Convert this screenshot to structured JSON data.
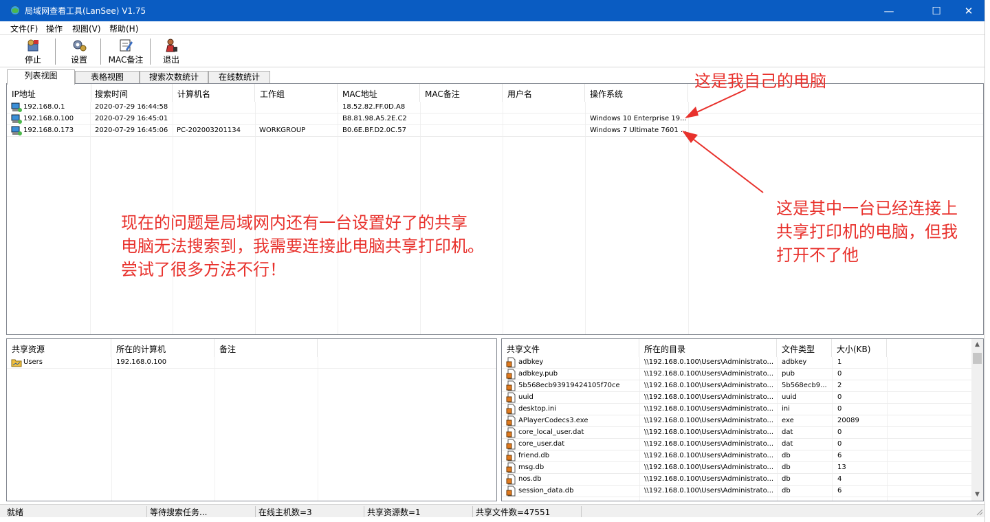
{
  "window": {
    "title": "局域网查看工具(LanSee) V1.75"
  },
  "menu": [
    "文件(F)",
    "操作",
    "视图(V)",
    "帮助(H)"
  ],
  "toolbar": {
    "stop": "停止",
    "settings": "设置",
    "mac_note": "MAC备注",
    "exit": "退出"
  },
  "tabs": [
    "列表视图",
    "表格视图",
    "搜索次数统计",
    "在线数统计"
  ],
  "hosts": {
    "columns": [
      "IP地址",
      "搜索时间",
      "计算机名",
      "工作组",
      "MAC地址",
      "MAC备注",
      "用户名",
      "操作系统"
    ],
    "rows": [
      [
        "192.168.0.1",
        "2020-07-29 16:44:58",
        "",
        "",
        "18.52.82.FF.0D.A8",
        "",
        "",
        ""
      ],
      [
        "192.168.0.100",
        "2020-07-29 16:45:01",
        "",
        "",
        "B8.81.98.A5.2E.C2",
        "",
        "",
        "Windows 10 Enterprise 19..."
      ],
      [
        "192.168.0.173",
        "2020-07-29 16:45:06",
        "PC-202003201134",
        "WORKGROUP",
        "B0.6E.BF.D2.0C.57",
        "",
        "",
        "Windows 7 Ultimate 7601 ..."
      ]
    ]
  },
  "shares": {
    "columns": [
      "共享资源",
      "所在的计算机",
      "备注"
    ],
    "rows": [
      [
        "Users",
        "192.168.0.100",
        ""
      ]
    ]
  },
  "files": {
    "columns": [
      "共享文件",
      "所在的目录",
      "文件类型",
      "大小(KB)"
    ],
    "rows": [
      [
        "adbkey",
        "\\\\192.168.0.100\\Users\\Administrato...",
        "adbkey",
        "1"
      ],
      [
        "adbkey.pub",
        "\\\\192.168.0.100\\Users\\Administrato...",
        "pub",
        "0"
      ],
      [
        "5b568ecb93919424105f70ce",
        "\\\\192.168.0.100\\Users\\Administrato...",
        "5b568ecb9...",
        "2"
      ],
      [
        "uuid",
        "\\\\192.168.0.100\\Users\\Administrato...",
        "uuid",
        "0"
      ],
      [
        "desktop.ini",
        "\\\\192.168.0.100\\Users\\Administrato...",
        "ini",
        "0"
      ],
      [
        "APlayerCodecs3.exe",
        "\\\\192.168.0.100\\Users\\Administrato...",
        "exe",
        "20089"
      ],
      [
        "core_local_user.dat",
        "\\\\192.168.0.100\\Users\\Administrato...",
        "dat",
        "0"
      ],
      [
        "core_user.dat",
        "\\\\192.168.0.100\\Users\\Administrato...",
        "dat",
        "0"
      ],
      [
        "friend.db",
        "\\\\192.168.0.100\\Users\\Administrato...",
        "db",
        "6"
      ],
      [
        "msg.db",
        "\\\\192.168.0.100\\Users\\Administrato...",
        "db",
        "13"
      ],
      [
        "nos.db",
        "\\\\192.168.0.100\\Users\\Administrato...",
        "db",
        "4"
      ],
      [
        "session_data.db",
        "\\\\192.168.0.100\\Users\\Administrato...",
        "db",
        "6"
      ]
    ]
  },
  "status": [
    "就绪",
    "等待搜索任务...",
    "在线主机数=3",
    "共享资源数=1",
    "共享文件数=47551"
  ],
  "annotations": {
    "my_pc": "这是我自己的电脑",
    "connected_lines": [
      "这是其中一台已经连接上",
      "共享打印机的电脑，但我",
      "打开不了他"
    ],
    "problem_lines": [
      "现在的问题是局域网内还有一台设置好了的共享",
      "电脑无法搜索到，我需要连接此电脑共享打印机。",
      "尝试了很多方法不行！"
    ]
  },
  "colors": {
    "titlebar": "#0a5cc2",
    "annotation": "#e8312c"
  }
}
